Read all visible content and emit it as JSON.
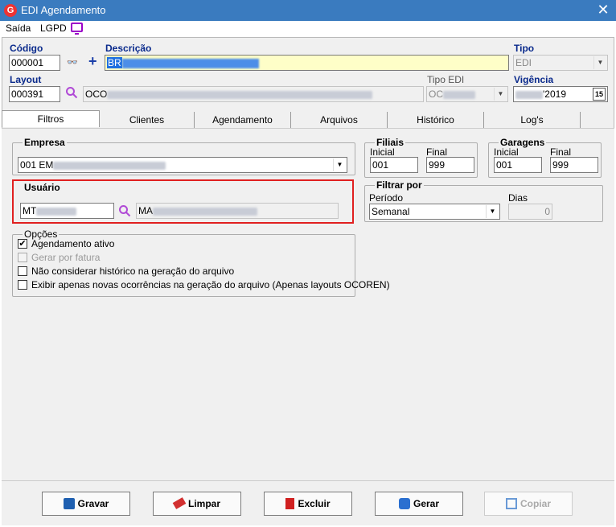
{
  "window": {
    "title": "EDI Agendamento",
    "close_glyph": "✕",
    "app_icon_letter": "G"
  },
  "menu": {
    "items": [
      "Saída",
      "LGPD"
    ]
  },
  "header": {
    "codigo_label": "Código",
    "codigo_value": "000001",
    "descricao_label": "Descrição",
    "descricao_value": "BR",
    "tipo_label": "Tipo",
    "tipo_value": "EDI",
    "layout_label": "Layout",
    "layout_value": "000391",
    "layout_desc": "OCO",
    "tipo_edi_label": "Tipo EDI",
    "tipo_edi_value": "OC",
    "vigencia_label": "Vigência",
    "vigencia_value": "'2019",
    "calendar_label": "15"
  },
  "tabs": [
    "Filtros",
    "Clientes",
    "Agendamento",
    "Arquivos",
    "Histórico",
    "Log's"
  ],
  "filtros": {
    "empresa_label": "Empresa",
    "empresa_value": "001 EM",
    "usuario_label": "Usuário",
    "usuario_code": "MT",
    "usuario_name": "MA",
    "filiais_label": "Filiais",
    "filiais_inicial_label": "Inicial",
    "filiais_final_label": "Final",
    "filiais_inicial": "001",
    "filiais_final": "999",
    "garagens_label": "Garagens",
    "garagens_inicial_label": "Inicial",
    "garagens_final_label": "Final",
    "garagens_inicial": "001",
    "garagens_final": "999",
    "filtrar_label": "Filtrar por",
    "periodo_label": "Período",
    "periodo_value": "Semanal",
    "dias_label": "Dias",
    "dias_value": "0",
    "opcoes_label": "Opções",
    "opcoes": [
      {
        "label": "Agendamento ativo",
        "checked": true,
        "disabled": false
      },
      {
        "label": "Gerar por fatura",
        "checked": false,
        "disabled": true
      },
      {
        "label": "Não considerar histórico na geração do arquivo",
        "checked": false,
        "disabled": false
      },
      {
        "label": "Exibir apenas novas ocorrências na geração do arquivo (Apenas layouts OCOREN)",
        "checked": false,
        "disabled": false
      }
    ]
  },
  "buttons": {
    "gravar": "Gravar",
    "limpar": "Limpar",
    "excluir": "Excluir",
    "gerar": "Gerar",
    "copiar": "Copiar"
  },
  "colors": {
    "accent": "#0a2a8c",
    "titlebar": "#3a7bbf",
    "highlight_frame": "#e02020",
    "purple_icon": "#9b00c8"
  }
}
